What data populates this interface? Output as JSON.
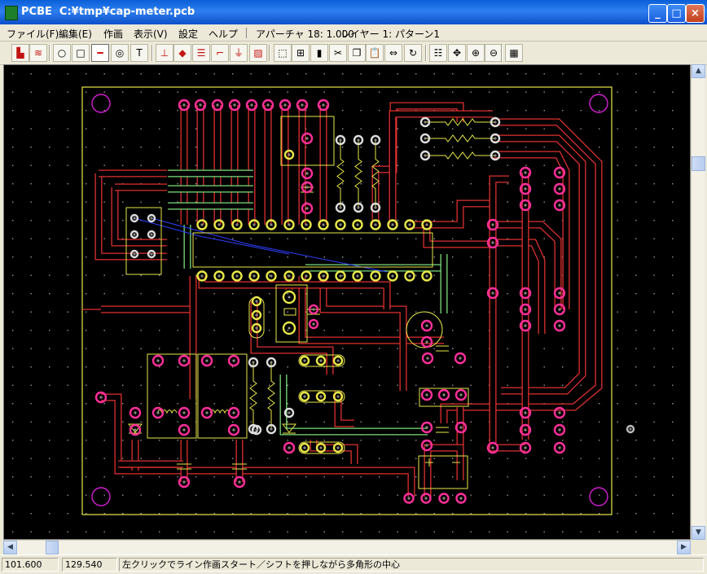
{
  "window": {
    "title": "PCBE  C:¥tmp¥cap-meter.pcb",
    "minimize_label": "_",
    "maximize_label": "□",
    "close_label": "×"
  },
  "menu": {
    "items": [
      "ファイル(F)",
      "編集(E)",
      "作画",
      "表示(V)",
      "設定",
      "ヘルプ"
    ],
    "aperture": "アパーチャ 18: 1.000",
    "layer": "レイヤー 1: パターン1"
  },
  "toolbar": {
    "tools": [
      {
        "name": "layer-color-icon",
        "glyph": "▙"
      },
      {
        "name": "layer-switch-icon",
        "glyph": "≋"
      },
      {
        "name": "circle-tool-icon",
        "glyph": "○"
      },
      {
        "name": "rectangle-tool-icon",
        "glyph": "□"
      },
      {
        "name": "line-tool-icon",
        "glyph": "━"
      },
      {
        "name": "pad-tool-icon",
        "glyph": "◎"
      },
      {
        "name": "text-tool-icon",
        "glyph": "T"
      },
      {
        "name": "junction-tool-icon",
        "glyph": "⊥"
      },
      {
        "name": "eraser-icon",
        "glyph": "◆"
      },
      {
        "name": "parallel-lines-icon",
        "glyph": "☰"
      },
      {
        "name": "corner-line-icon",
        "glyph": "⌐"
      },
      {
        "name": "bus-line-icon",
        "glyph": "⏚"
      },
      {
        "name": "fill-area-icon",
        "glyph": "▨"
      },
      {
        "name": "select-area-icon",
        "glyph": "⬚"
      },
      {
        "name": "group-icon",
        "glyph": "⊞"
      },
      {
        "name": "component-icon",
        "glyph": "▮"
      },
      {
        "name": "cut-icon",
        "glyph": "✂"
      },
      {
        "name": "copy-icon",
        "glyph": "❐"
      },
      {
        "name": "paste-icon",
        "glyph": "📋"
      },
      {
        "name": "mirror-icon",
        "glyph": "⇔"
      },
      {
        "name": "rotate-icon",
        "glyph": "↻"
      },
      {
        "name": "list-icon",
        "glyph": "☷"
      },
      {
        "name": "pan-icon",
        "glyph": "✥"
      },
      {
        "name": "zoom-in-icon",
        "glyph": "⊕"
      },
      {
        "name": "zoom-out-icon",
        "glyph": "⊖"
      },
      {
        "name": "grid-icon",
        "glyph": "▦"
      }
    ]
  },
  "scroll": {
    "up": "▲",
    "down": "▼",
    "left": "◀",
    "right": "▶"
  },
  "status": {
    "x": "101.600",
    "y": "129.540",
    "message": "左クリックでライン作画スタート／シフトを押しながら多角形の中心"
  },
  "colors": {
    "canvas": "#000000",
    "trace": "#e03030",
    "pad": "#ff2f9a",
    "silk": "#e8e84a",
    "jumper": "#7ce07c",
    "ratsnest": "#2f3fff",
    "outline": "#ffffff"
  }
}
